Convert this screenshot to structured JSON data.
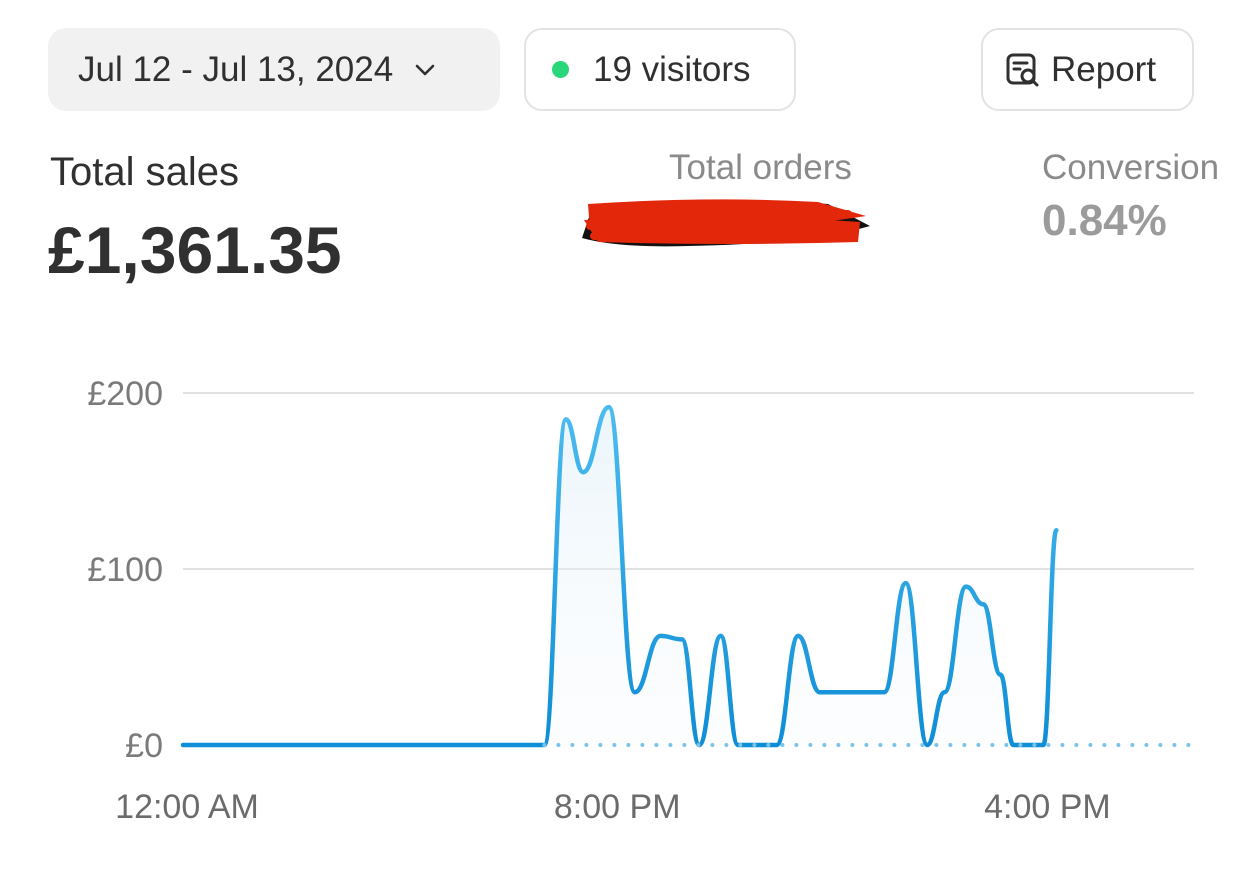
{
  "header": {
    "date_range": "Jul 12 - Jul 13, 2024",
    "visitors": "19 visitors",
    "report_label": "Report",
    "visitor_dot_color": "#29d67a",
    "icons": {
      "date_dropdown": "chevron-down-icon",
      "report": "report-search-icon"
    }
  },
  "metrics": {
    "total_sales": {
      "label": "Total sales",
      "value": "£1,361.35"
    },
    "total_orders": {
      "label": "Total orders",
      "value_redacted": true
    },
    "conversion": {
      "label": "Conversion",
      "value": "0.84%"
    }
  },
  "chart_data": {
    "type": "line",
    "ylabel": "",
    "xlabel": "",
    "y_ticks": [
      "£200",
      "£100",
      "£0"
    ],
    "ylim": [
      0,
      200
    ],
    "x_ticks": [
      {
        "label": "12:00 AM",
        "x": 0
      },
      {
        "label": "8:00 PM",
        "x": 10
      },
      {
        "label": "4:00 PM",
        "x": 20
      }
    ],
    "xlim": [
      0,
      23.5
    ],
    "grid": true,
    "line_color": "#2aa3dc",
    "series": [
      {
        "points": [
          [
            0,
            0
          ],
          [
            8,
            0
          ],
          [
            8.4,
            0
          ],
          [
            8.9,
            185
          ],
          [
            9.3,
            155
          ],
          [
            9.9,
            192
          ],
          [
            10.5,
            30
          ],
          [
            11.1,
            62
          ],
          [
            11.6,
            60
          ],
          [
            12.0,
            0
          ],
          [
            12.5,
            62
          ],
          [
            12.9,
            0
          ],
          [
            13.8,
            0
          ],
          [
            14.3,
            62
          ],
          [
            14.8,
            30
          ],
          [
            16.3,
            30
          ],
          [
            16.8,
            92
          ],
          [
            17.3,
            0
          ],
          [
            17.7,
            30
          ],
          [
            18.2,
            90
          ],
          [
            18.6,
            80
          ],
          [
            19.0,
            40
          ],
          [
            19.3,
            0
          ],
          [
            20.0,
            0
          ],
          [
            20.3,
            122
          ]
        ]
      },
      {
        "style": "dotted",
        "points": [
          [
            8.4,
            0
          ],
          [
            23.5,
            0
          ]
        ]
      }
    ]
  }
}
